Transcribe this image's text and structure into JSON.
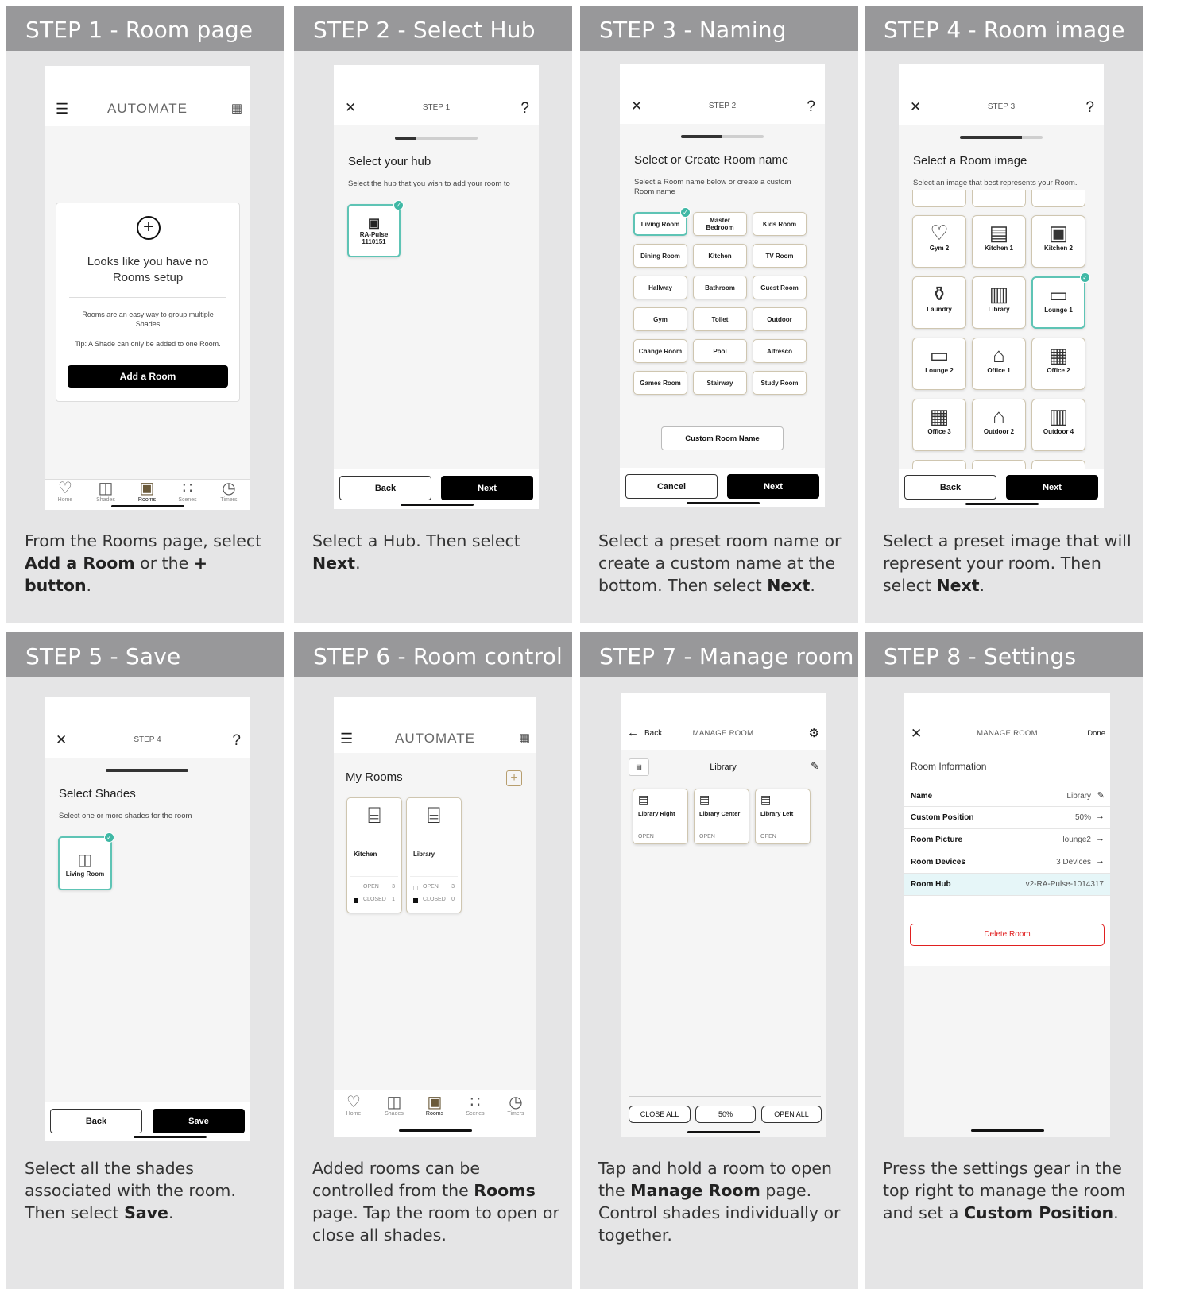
{
  "steps": [
    {
      "title": "STEP 1 - Room page"
    },
    {
      "title": "STEP 2 - Select Hub"
    },
    {
      "title": "STEP 3 - Naming"
    },
    {
      "title": "STEP 4 - Room image"
    },
    {
      "title": "STEP 5 - Save"
    },
    {
      "title": "STEP 6 - Room control"
    },
    {
      "title": "STEP 7 - Manage room"
    },
    {
      "title": "STEP 8 - Settings"
    }
  ],
  "desc": {
    "s1": {
      "a": "From the Rooms page, select ",
      "b1": "Add a Room",
      "c": " or the ",
      "b2": "+ button",
      "d": "."
    },
    "s2": {
      "a": "Select a Hub. Then select ",
      "b1": "Next",
      "c": "."
    },
    "s3": {
      "a": "Select a preset room name or create a custom name at the bottom. Then select ",
      "b1": "Next",
      "c": "."
    },
    "s4": {
      "a": "Select a preset image that will represent your room. Then select ",
      "b1": "Next",
      "c": "."
    },
    "s5": {
      "a": "Select all the shades associated with the room. Then select ",
      "b1": "Save",
      "c": "."
    },
    "s6": {
      "a": "Added rooms can be controlled from the ",
      "b1": "Rooms",
      "c": " page. Tap the room to open or close all shades."
    },
    "s7": {
      "a": "Tap and hold a room to open the ",
      "b1": "Manage Room",
      "c": " page. Control shades individually or together."
    },
    "s8": {
      "a": "Press the settings gear in the top right to manage the room and set a ",
      "b1": "Custom Position",
      "c": "."
    }
  },
  "app": {
    "logo": "AUTOMATE",
    "back": "Back",
    "next": "Next",
    "cancel": "Cancel",
    "save": "Save"
  },
  "tabs": [
    "Home",
    "Shades",
    "Rooms",
    "Scenes",
    "Timers"
  ],
  "p1": {
    "empty_line1": "Looks like you have no",
    "empty_line2": "Rooms setup",
    "info": "Rooms are an easy way to group multiple Shades",
    "tip": "Tip: A Shade can only be added to one Room.",
    "add": "Add a Room"
  },
  "p2": {
    "step": "STEP 1",
    "title": "Select your hub",
    "sub": "Select the hub that you wish to add your room to",
    "hub_name": "RA-Pulse",
    "hub_id": "1110151"
  },
  "p3": {
    "step": "STEP 2",
    "title": "Select or Create Room name",
    "sub": "Select a Room name below or create a custom Room name",
    "names": [
      "Living Room",
      "Master Bedroom",
      "Kids Room",
      "Dining Room",
      "Kitchen",
      "TV Room",
      "Hallway",
      "Bathroom",
      "Guest Room",
      "Gym",
      "Toilet",
      "Outdoor",
      "Change Room",
      "Pool",
      "Alfresco",
      "Games Room",
      "Stairway",
      "Study Room"
    ],
    "custom": "Custom Room Name"
  },
  "p4": {
    "step": "STEP 3",
    "title": "Select a Room image",
    "sub": "Select an image that best represents your Room.",
    "images": [
      "Gym 2",
      "Kitchen 1",
      "Kitchen 2",
      "Laundry",
      "Library",
      "Lounge 1",
      "Lounge 2",
      "Office 1",
      "Office 2",
      "Office 3",
      "Outdoor 2",
      "Outdoor 4"
    ]
  },
  "p5": {
    "step": "STEP 4",
    "title": "Select Shades",
    "sub": "Select one or more shades for the room",
    "shade": "Living Room"
  },
  "p6": {
    "title": "My Rooms",
    "rooms": [
      {
        "name": "Kitchen",
        "open": "OPEN",
        "open_n": "3",
        "closed": "CLOSED",
        "closed_n": "1"
      },
      {
        "name": "Library",
        "open": "OPEN",
        "open_n": "3",
        "closed": "CLOSED",
        "closed_n": "0"
      }
    ]
  },
  "p7": {
    "back": "Back",
    "title": "MANAGE ROOM",
    "room": "Library",
    "shades": [
      {
        "name": "Library Right",
        "state": "OPEN"
      },
      {
        "name": "Library Center",
        "state": "OPEN"
      },
      {
        "name": "Library Left",
        "state": "OPEN"
      }
    ],
    "close_all": "CLOSE ALL",
    "half": "50%",
    "open_all": "OPEN ALL"
  },
  "p8": {
    "title": "MANAGE ROOM",
    "done": "Done",
    "section": "Room Information",
    "rows": [
      {
        "label": "Name",
        "value": "Library"
      },
      {
        "label": "Custom Position",
        "value": "50%"
      },
      {
        "label": "Room Picture",
        "value": "lounge2"
      },
      {
        "label": "Room Devices",
        "value": "3 Devices"
      },
      {
        "label": "Room Hub",
        "value": "v2-RA-Pulse-1014317"
      }
    ],
    "delete": "Delete Room"
  },
  "colors": {
    "header": "#98989a",
    "card": "#e5e5e6",
    "accent": "#3fb8a5",
    "danger": "#e02020"
  }
}
